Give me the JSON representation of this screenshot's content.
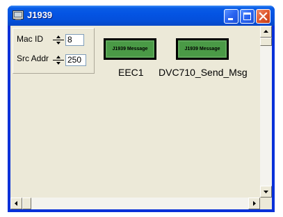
{
  "window": {
    "title": "J1939"
  },
  "icons": {
    "app": "app-icon",
    "minimize": "minimize-icon",
    "maximize": "maximize-icon",
    "close": "close-icon"
  },
  "panel": {
    "mac_id": {
      "label": "Mac ID",
      "value": "8"
    },
    "src_addr": {
      "label": "Src Addr",
      "value": "250"
    }
  },
  "messages": [
    {
      "block_label": "J1939 Message",
      "caption": "EEC1"
    },
    {
      "block_label": "J1939 Message",
      "caption": "DVC710_Send_Msg"
    }
  ],
  "colors": {
    "titlebar": "#0454e3",
    "client": "#ece9d8",
    "message_block": "#4a9a46",
    "close_button": "#e05a2f"
  }
}
